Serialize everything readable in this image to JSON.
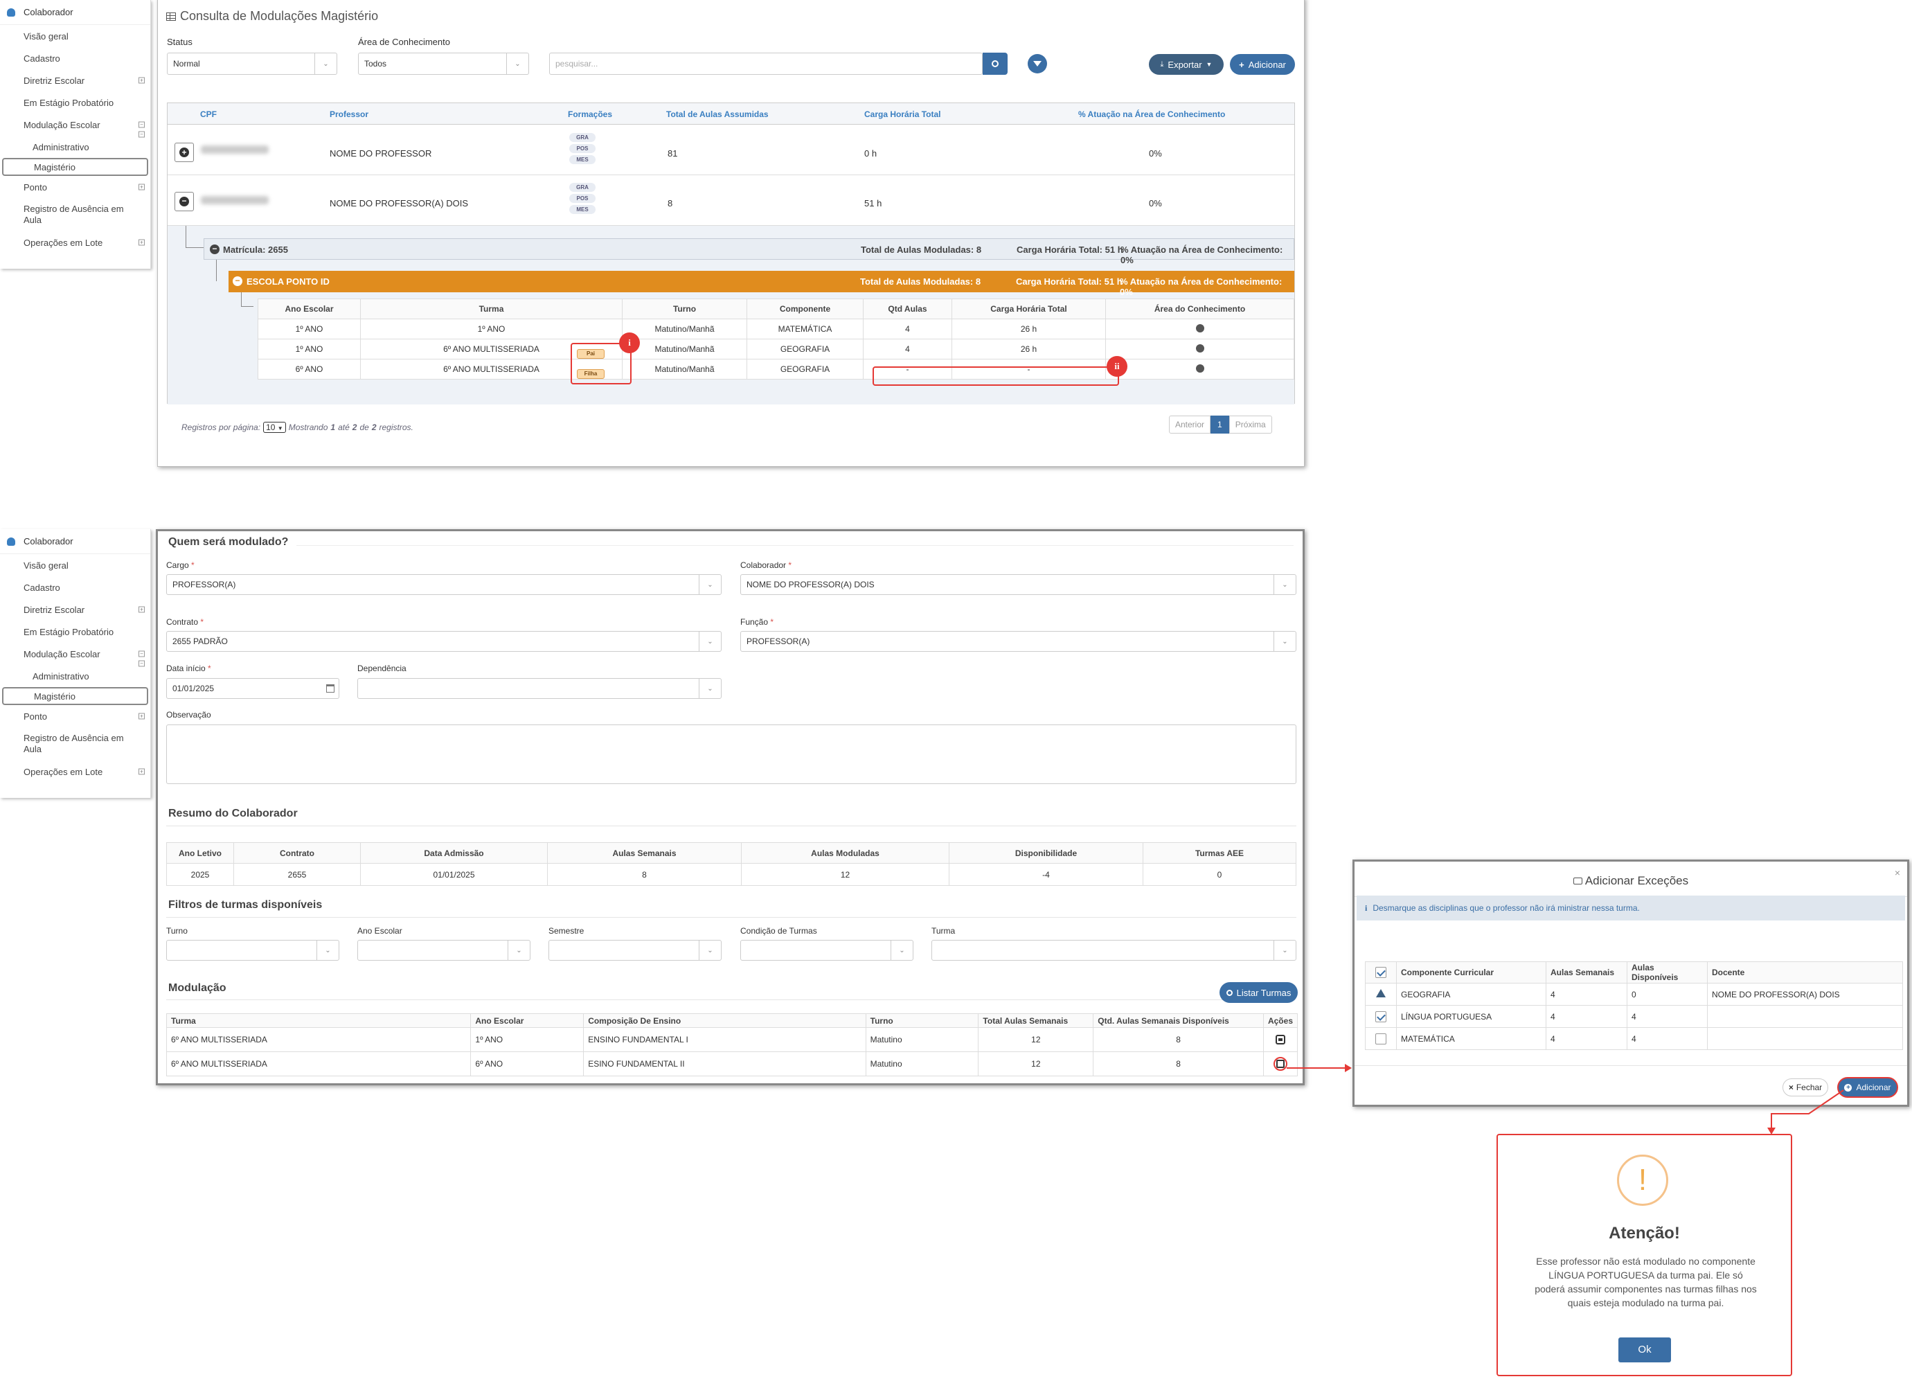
{
  "sidebar": {
    "title": "Colaborador",
    "items": [
      {
        "label": "Visão geral"
      },
      {
        "label": "Cadastro"
      },
      {
        "label": "Diretriz Escolar"
      },
      {
        "label": "Em Estágio Probatório"
      },
      {
        "label": "Modulação Escolar"
      },
      {
        "label": "Administrativo"
      },
      {
        "label": "Magistério"
      },
      {
        "label": "Ponto"
      },
      {
        "label": "Registro de Ausência em Aula"
      },
      {
        "label": "Operações em Lote"
      }
    ]
  },
  "consulta": {
    "title": "Consulta de Modulações Magistério",
    "status_label": "Status",
    "status_value": "Normal",
    "area_label": "Área de Conhecimento",
    "area_value": "Todos",
    "search_placeholder": "pesquisar...",
    "export_label": "Exportar",
    "add_label": "Adicionar",
    "columns": [
      "CPF",
      "Professor",
      "Formações",
      "Total de Aulas Assumidas",
      "Carga Horária Total",
      "% Atuação na Área de Conhecimento"
    ],
    "rows": [
      {
        "professor": "NOME DO PROFESSOR",
        "formacoes": [
          "GRA",
          "POS",
          "MES"
        ],
        "total_aulas": "81",
        "carga": "0 h",
        "atuacao": "0%"
      },
      {
        "professor": "NOME DO PROFESSOR(A) DOIS",
        "formacoes": [
          "GRA",
          "POS",
          "MES"
        ],
        "total_aulas": "8",
        "carga": "51 h",
        "atuacao": "0%"
      }
    ],
    "matricula": {
      "label": "Matrícula: 2655",
      "total": "Total de Aulas Moduladas: 8",
      "carga": "Carga Horária Total: 51 h",
      "atuacao": "% Atuação na Área de Conhecimento: 0%"
    },
    "escola": {
      "label": "ESCOLA PONTO ID",
      "total": "Total de Aulas Moduladas: 8",
      "carga": "Carga Horária Total: 51 h",
      "atuacao": "% Atuação na Área de Conhecimento: 0%"
    },
    "sub_columns": [
      "Ano Escolar",
      "Turma",
      "Turno",
      "Componente",
      "Qtd Aulas",
      "Carga Horária Total",
      "Área do Conhecimento"
    ],
    "sub_rows": [
      {
        "ano": "1º ANO",
        "turma": "1º ANO",
        "tag": "",
        "turno": "Matutino/Manhã",
        "componente": "MATEMÁTICA",
        "qtd": "4",
        "carga": "26 h"
      },
      {
        "ano": "1º ANO",
        "turma": "6º ANO MULTISSERIADA",
        "tag": "Pai",
        "turno": "Matutino/Manhã",
        "componente": "GEOGRAFIA",
        "qtd": "4",
        "carga": "26 h"
      },
      {
        "ano": "6º ANO",
        "turma": "6º ANO MULTISSERIADA",
        "tag": "Filha",
        "turno": "Matutino/Manhã",
        "componente": "GEOGRAFIA",
        "qtd": "-",
        "carga": "-"
      }
    ],
    "badge_i": "i",
    "badge_ii": "ii",
    "pager": {
      "per_page_label": "Registros por página:",
      "per_page": "10",
      "mostrando": "Mostrando",
      "from": "1",
      "ate": "até",
      "to": "2",
      "de": "de",
      "total": "2",
      "registros": "registros.",
      "prev": "Anterior",
      "page": "1",
      "next": "Próxima"
    }
  },
  "form": {
    "section_title": "Quem será modulado?",
    "cargo_label": "Cargo",
    "cargo_value": "PROFESSOR(A)",
    "colaborador_label": "Colaborador",
    "colaborador_value": "NOME DO PROFESSOR(A) DOIS",
    "contrato_label": "Contrato",
    "contrato_value": "2655 PADRÃO",
    "funcao_label": "Função",
    "funcao_value": "PROFESSOR(A)",
    "data_label": "Data início",
    "data_value": "01/01/2025",
    "dependencia_label": "Dependência",
    "observacao_label": "Observação",
    "resumo_title": "Resumo do Colaborador",
    "resumo_columns": [
      "Ano Letivo",
      "Contrato",
      "Data Admissão",
      "Aulas Semanais",
      "Aulas Moduladas",
      "Disponibilidade",
      "Turmas AEE"
    ],
    "resumo_values": [
      "2025",
      "2655",
      "01/01/2025",
      "8",
      "12",
      "-4",
      "0"
    ],
    "filtros_title": "Filtros de turmas disponíveis",
    "filtro_turno": "Turno",
    "filtro_ano": "Ano Escolar",
    "filtro_semestre": "Semestre",
    "filtro_condicao": "Condição de Turmas",
    "filtro_turma": "Turma",
    "modulacao_title": "Modulação",
    "listar_label": "Listar Turmas",
    "mod_columns": [
      "Turma",
      "Ano Escolar",
      "Composição De Ensino",
      "Turno",
      "Total Aulas Semanais",
      "Qtd. Aulas Semanais Disponíveis",
      "Ações"
    ],
    "mod_rows": [
      [
        "6º ANO MULTISSERIADA",
        "1º ANO",
        "ENSINO FUNDAMENTAL I",
        "Matutino",
        "12",
        "8"
      ],
      [
        "6º ANO MULTISSERIADA",
        "6º ANO",
        "ESINO FUNDAMENTAL II",
        "Matutino",
        "12",
        "8"
      ]
    ]
  },
  "modal": {
    "title": "Adicionar Exceções",
    "info": "Desmarque as disciplinas que o professor não irá ministrar nessa turma.",
    "columns": [
      "Componente Curricular",
      "Aulas Semanais",
      "Aulas Disponíveis",
      "Docente"
    ],
    "rows": [
      {
        "comp": "GEOGRAFIA",
        "sem": "4",
        "disp": "0",
        "docente": "NOME DO PROFESSOR(A) DOIS",
        "state": "warn"
      },
      {
        "comp": "LÍNGUA PORTUGUESA",
        "sem": "4",
        "disp": "4",
        "docente": "",
        "state": "on"
      },
      {
        "comp": "MATEMÁTICA",
        "sem": "4",
        "disp": "4",
        "docente": "",
        "state": "off"
      }
    ],
    "fechar": "Fechar",
    "adicionar": "Adicionar"
  },
  "alert": {
    "icon": "!",
    "title": "Atenção!",
    "message": "Esse professor não está modulado no componente LÍNGUA PORTUGUESA da turma pai. Ele só poderá assumir componentes nas turmas filhas nos quais esteja modulado na turma pai.",
    "ok": "Ok"
  },
  "colors": {
    "primary": "#3a6ea5",
    "orange": "#e08c1e",
    "red": "#e53935",
    "warn_orange": "#f0ad4e"
  }
}
